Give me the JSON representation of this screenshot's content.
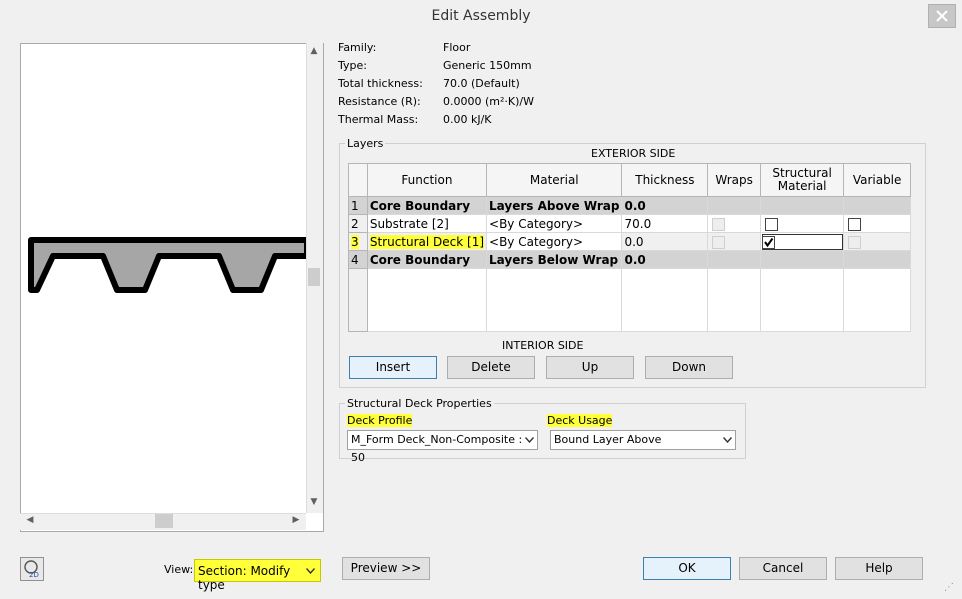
{
  "window": {
    "title": "Edit Assembly"
  },
  "info": [
    {
      "label": "Family:",
      "value": "Floor"
    },
    {
      "label": "Type:",
      "value": "Generic 150mm"
    },
    {
      "label": "Total thickness:",
      "value": "70.0 (Default)"
    },
    {
      "label": "Resistance (R):",
      "value": "0.0000 (m²·K)/W"
    },
    {
      "label": "Thermal Mass:",
      "value": "0.00 kJ/K"
    }
  ],
  "layers": {
    "group_title": "Layers",
    "exterior_label": "EXTERIOR SIDE",
    "interior_label": "INTERIOR SIDE",
    "columns": [
      "Function",
      "Material",
      "Thickness",
      "Wraps",
      "Structural Material",
      "Variable"
    ],
    "rows": [
      {
        "num": "1",
        "function": "Core Boundary",
        "material": "Layers Above Wrap",
        "thickness": "0.0"
      },
      {
        "num": "2",
        "function": "Substrate [2]",
        "material": "<By Category>",
        "thickness": "70.0"
      },
      {
        "num": "3",
        "function": "Structural Deck [1]",
        "material": "<By Category>",
        "thickness": "0.0"
      },
      {
        "num": "4",
        "function": "Core Boundary",
        "material": "Layers Below Wrap",
        "thickness": "0.0"
      }
    ],
    "buttons": {
      "insert": "Insert",
      "delete": "Delete",
      "up": "Up",
      "down": "Down"
    }
  },
  "deck": {
    "group_title": "Structural Deck Properties",
    "profile_label": "Deck Profile",
    "profile_value": "M_Form Deck_Non-Composite : 50",
    "usage_label": "Deck Usage",
    "usage_value": "Bound Layer Above"
  },
  "footer": {
    "view_label": "View:",
    "view_value": "Section: Modify type",
    "preview": "Preview >>",
    "ok": "OK",
    "cancel": "Cancel",
    "help": "Help"
  },
  "colors": {
    "highlight": "#ffff3a",
    "core_row": "#d3d3d3",
    "focus_border": "#3c7fb1"
  },
  "icons": [
    "close-icon",
    "scroll-up-icon",
    "scroll-down-icon",
    "scroll-left-icon",
    "scroll-right-icon",
    "view-2d-icon",
    "dropdown-arrow-icon",
    "checkmark-icon"
  ]
}
